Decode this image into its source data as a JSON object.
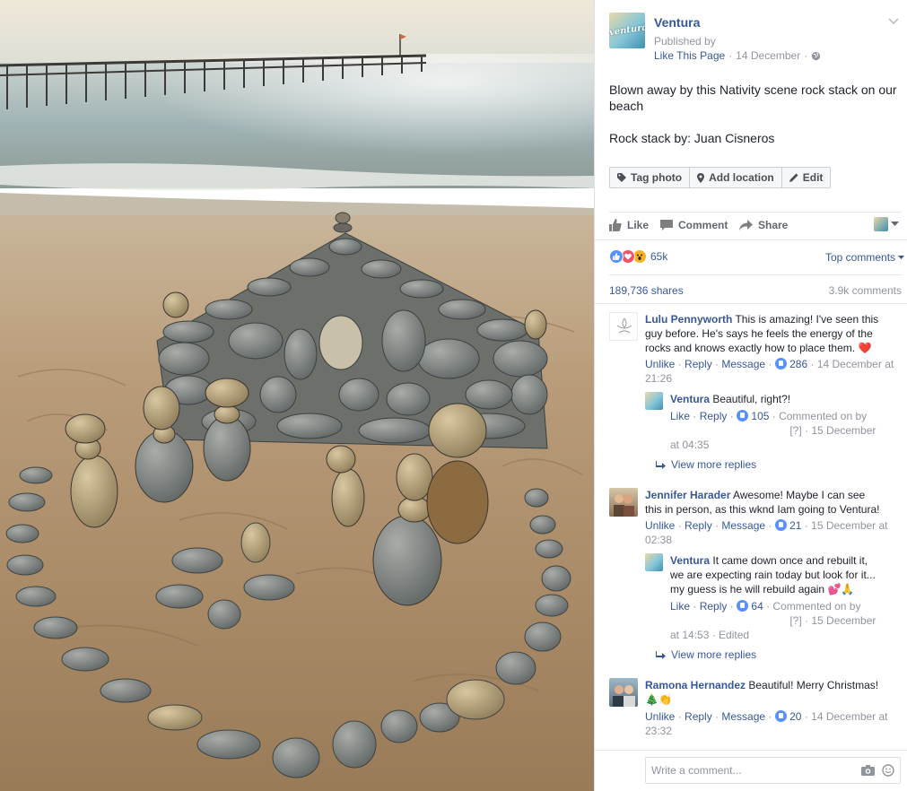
{
  "post": {
    "page_name": "Ventura",
    "avatar_text": "ventura",
    "published_by": "Published by",
    "publisher": "Like This Page",
    "date": "14 December",
    "meta_sep": "·",
    "text_line1": "Blown away by this Nativity scene rock stack on our beach",
    "text_line2": "Rock stack by: Juan Cisneros"
  },
  "photo_actions": {
    "tag": "Tag photo",
    "location": "Add location",
    "edit": "Edit"
  },
  "actions": {
    "like": "Like",
    "comment": "Comment",
    "share": "Share"
  },
  "reactions": {
    "count": "65k",
    "sort": "Top comments"
  },
  "stats": {
    "shares": "189,736 shares",
    "comments": "3.9k comments"
  },
  "comments": [
    {
      "name": "Lulu Pennyworth",
      "text": "This is amazing! I've seen this guy before. He's says he feels the energy of the rocks and knows exactly how to place them.",
      "emoji": "❤️",
      "unlike": "Unlike",
      "reply": "Reply",
      "message": "Message",
      "likes": "286",
      "time": "14 December",
      "time2": "at 21:26",
      "reply_item": {
        "name": "Ventura",
        "text": "Beautiful, right?!",
        "like": "Like",
        "reply": "Reply",
        "likes": "105",
        "commented_on_by": "Commented on by",
        "hidden": "[?]",
        "time": "15 December",
        "time2": "at 04:35"
      },
      "view_more": "View more replies"
    },
    {
      "name": "Jennifer Harader",
      "text": "Awesome! Maybe I can see this in person, as this wknd Iam going to Ventura!",
      "unlike": "Unlike",
      "reply": "Reply",
      "message": "Message",
      "likes": "21",
      "time": "15 December at",
      "time2": "02:38",
      "reply_item": {
        "name": "Ventura",
        "text": "It came down once and rebuilt it, we are expecting rain today but look for it... my guess is he will rebuild again",
        "emoji": "💕🙏",
        "like": "Like",
        "reply": "Reply",
        "likes": "64",
        "commented_on_by": "Commented on by",
        "hidden": "[?]",
        "time": "15 December",
        "time2": "at 14:53 · Edited"
      },
      "view_more": "View more replies"
    },
    {
      "name": "Ramona Hernandez",
      "text": "Beautiful! Merry Christmas!",
      "emoji": "🎄👏",
      "unlike": "Unlike",
      "reply": "Reply",
      "message": "Message",
      "likes": "20",
      "time": "14 December at",
      "time2": "23:32"
    }
  ],
  "composer": {
    "placeholder": "Write a comment..."
  },
  "colors": {
    "link": "#365899",
    "like_blue": "#5890ff",
    "love_red": "#f25268",
    "wow_yellow": "#f7b125",
    "meta_grey": "#90949c"
  }
}
